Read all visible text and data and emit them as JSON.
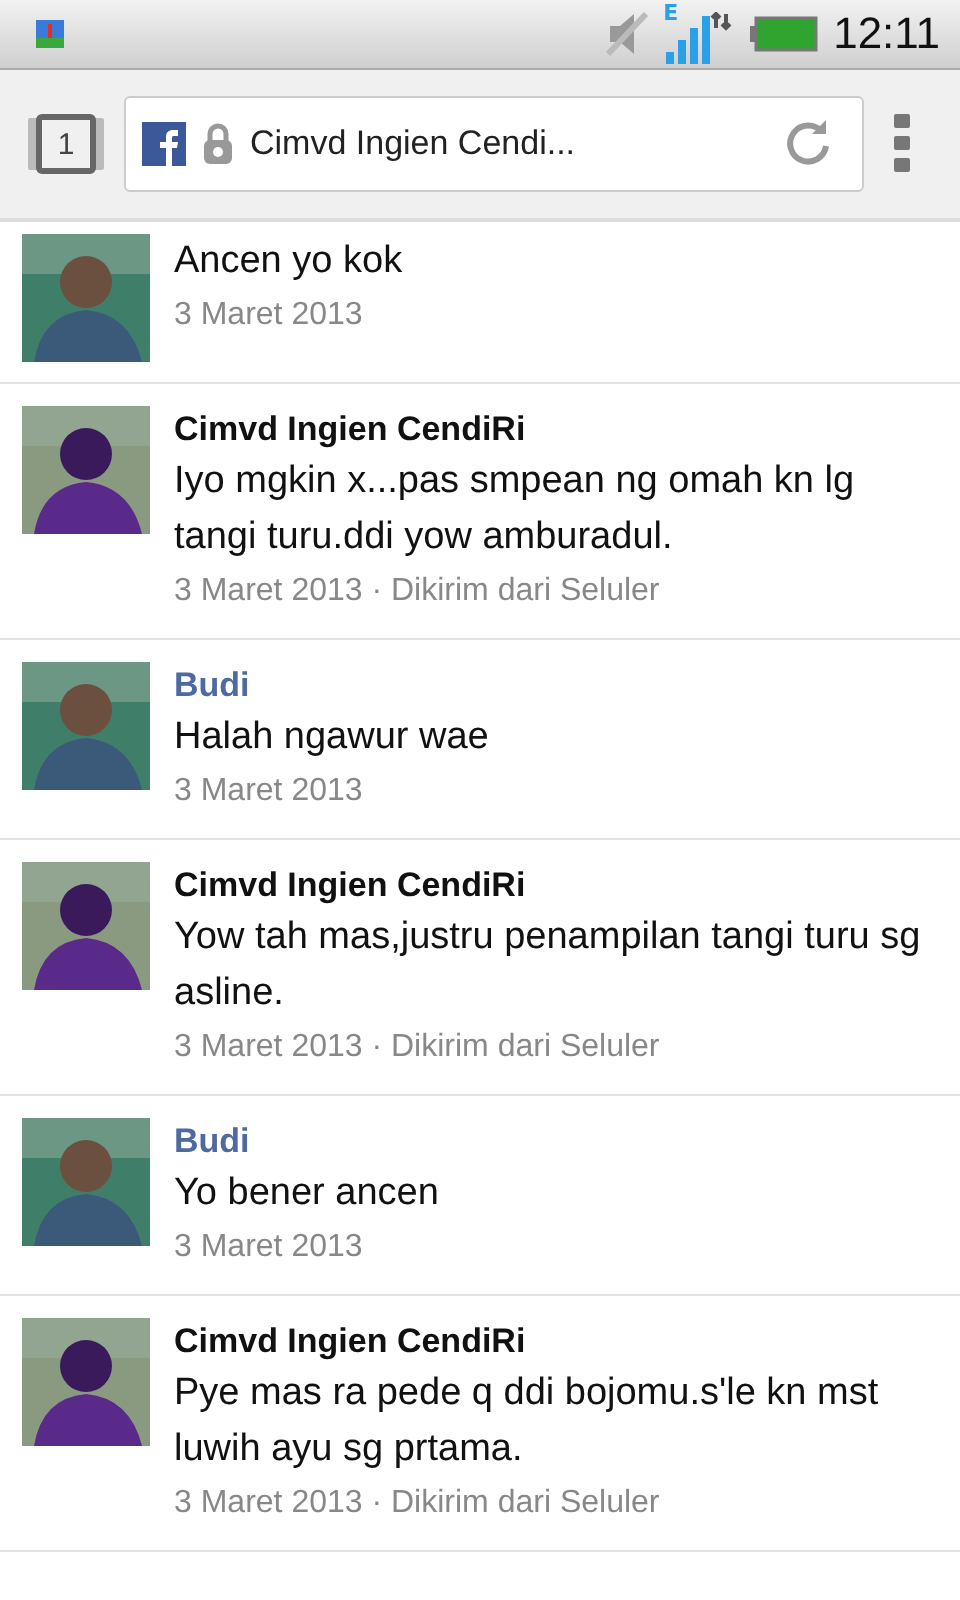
{
  "status_bar": {
    "time": "12:11",
    "network": "E"
  },
  "browser": {
    "tab_count": "1",
    "url_title": "Cimvd Ingien Cendi..."
  },
  "messages": [
    {
      "kind": "friend",
      "text": "Ancen yo kok",
      "meta": "3 Maret 2013"
    },
    {
      "kind": "self",
      "author": "Cimvd Ingien CendiRi",
      "text": "Iyo mgkin x...pas smpean ng omah kn lg tangi turu.ddi yow amburadul.",
      "meta": "3 Maret 2013 · Dikirim dari Seluler"
    },
    {
      "kind": "friend",
      "author": "Budi",
      "text": "Halah ngawur wae",
      "meta": "3 Maret 2013"
    },
    {
      "kind": "self",
      "author": "Cimvd Ingien CendiRi",
      "text": "Yow tah mas,justru penampilan tangi turu sg asline.",
      "meta": "3 Maret 2013 · Dikirim dari Seluler"
    },
    {
      "kind": "friend",
      "author": "Budi",
      "text": "Yo bener ancen",
      "meta": "3 Maret 2013"
    },
    {
      "kind": "self",
      "author": "Cimvd Ingien CendiRi",
      "text": "Pye mas ra pede q ddi bojomu.s'le kn mst luwih ayu sg prtama.",
      "meta": "3 Maret 2013 · Dikirim dari Seluler"
    }
  ]
}
